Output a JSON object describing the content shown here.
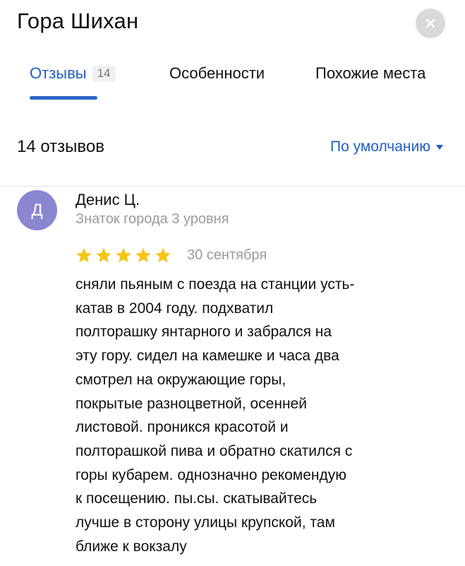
{
  "header": {
    "title": "Гора Шихан",
    "close_icon": "close-icon"
  },
  "tabs": [
    {
      "label": "Отзывы",
      "count": "14",
      "active": true
    },
    {
      "label": "Особенности"
    },
    {
      "label": "Похожие места"
    }
  ],
  "summary": {
    "review_count_label": "14 отзывов",
    "sort_label": "По умолчанию",
    "sort_icon": "caret-down-icon"
  },
  "review": {
    "avatar_letter": "Д",
    "author": "Денис Ц.",
    "level": "Знаток города 3 уровня",
    "rating": 5,
    "date": "30 сентября",
    "text_lines": [
      "сняли пьяным с поезда на станции усть-",
      "катав в 2004 году. подхватил",
      "полторашку янтарного и забрался на",
      "эту гору. сидел на камешке и часа два",
      "смотрел на окружающие горы,",
      "покрытые разноцветной, осенней",
      "листовой. проникся красотой и",
      "полторашкой пива и обратно скатился с",
      "горы кубарем. однозначно рекомендую",
      "к посещению. пы.сы. скатывайтесь",
      "лучше в сторону улицы крупской, там",
      "ближе к вокзалу"
    ]
  },
  "colors": {
    "accent": "#2d64c8",
    "link": "#1f5fbf",
    "star": "#f5c518",
    "avatar_bg": "#8a87d1",
    "muted_text": "#9a9a9a"
  }
}
